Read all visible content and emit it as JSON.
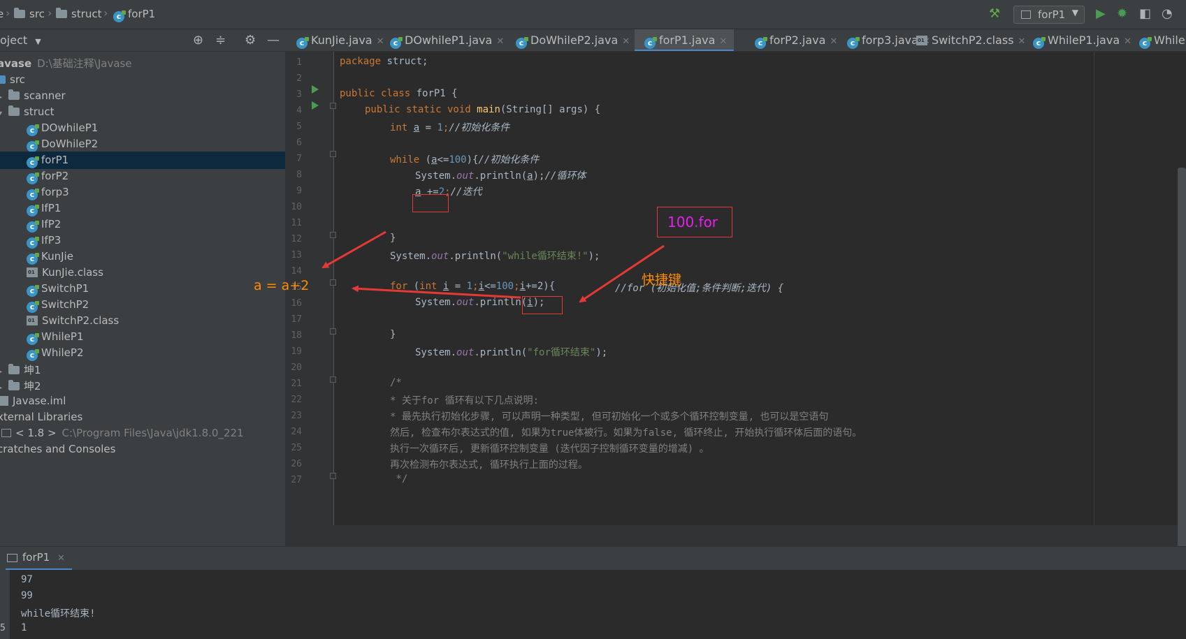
{
  "navbar": {
    "breadcrumbs": [
      "src",
      "struct",
      "forP1"
    ],
    "run_config": "forP1"
  },
  "project_panel": {
    "title": "oject"
  },
  "tabs": [
    {
      "label": "KunJie.java",
      "active": false
    },
    {
      "label": "DOwhileP1.java",
      "active": false
    },
    {
      "label": "DoWhileP2.java",
      "active": false
    },
    {
      "label": "forP1.java",
      "active": true
    },
    {
      "label": "forP2.java",
      "active": false
    },
    {
      "label": "forp3.java",
      "active": false
    },
    {
      "label": "SwitchP2.class",
      "active": false
    },
    {
      "label": "WhileP1.java",
      "active": false
    },
    {
      "label": "While",
      "active": false
    }
  ],
  "tree": {
    "root": {
      "name": "avase",
      "path": "D:\\基础注释\\Javase"
    },
    "src": "src",
    "scanner": "scanner",
    "struct": "struct",
    "files": [
      "DOwhileP1",
      "DoWhileP2",
      "forP1",
      "forP2",
      "forp3",
      "IfP1",
      "IfP2",
      "IfP3",
      "KunJie",
      "KunJie.class",
      "SwitchP1",
      "SwitchP2",
      "SwitchP2.class",
      "WhileP1",
      "WhileP2"
    ],
    "selected": "forP1",
    "folder_kun1": "坤1",
    "folder_kun2": "坤2",
    "iml": "Javase.iml",
    "external_libraries": "xternal Libraries",
    "jdk": {
      "name": "< 1.8 >",
      "path": "C:\\Program Files\\Java\\jdk1.8.0_221"
    },
    "scratches": "cratches and Consoles"
  },
  "editor": {
    "line_numbers": [
      "1",
      "2",
      "3",
      "4",
      "5",
      "6",
      "7",
      "8",
      "9",
      "10",
      "11",
      "12",
      "13",
      "14",
      "15",
      "16",
      "17",
      "18",
      "19",
      "20",
      "21",
      "22",
      "23",
      "24",
      "25",
      "26",
      "27"
    ],
    "code": {
      "l1_kw": "package",
      "l1_rest": " struct;",
      "l3_kw": "public class",
      "l3_rest": " forP1 {",
      "l4_kw": "public static void",
      "l4_meth": "main",
      "l4_rest": "(String[] args) {",
      "l5_kw": "int",
      "l5_var": "a",
      "l5_mid": " = ",
      "l5_num": "1",
      "l5_semi": ";",
      "l5_cmt": "//初始化条件",
      "l7_kw": "while",
      "l7_open": " (",
      "l7_var": "a",
      "l7_op": "<=",
      "l7_num": "100",
      "l7_close": "){",
      "l7_cmt": "//初始化条件",
      "l8_pre": "System.",
      "l8_field": "out",
      "l8_mid": ".println(",
      "l8_var": "a",
      "l8_end": ");",
      "l8_cmt": "//循环体",
      "l9_var": "a",
      "l9_op": " +=",
      "l9_num": "2",
      "l9_semi": ";",
      "l9_cmt": "//迭代",
      "l12": "}",
      "l13_pre": "System.",
      "l13_field": "out",
      "l13_mid": ".println(",
      "l13_str": "\"while循环结束!\"",
      "l13_end": ");",
      "l15_kw": "for",
      "l15_open": " (",
      "l15_kw2": "int",
      "l15_var": "i",
      "l15_eq": " = ",
      "l15_num": "1",
      "l15_semi1": ";",
      "l15_var2": "i",
      "l15_op": "<=",
      "l15_num2": "100",
      "l15_semi2": ";",
      "l15_var3": "i",
      "l15_inc": "+=2",
      "l15_close": "){",
      "l16_pre": "System.",
      "l16_field": "out",
      "l16_mid": ".println(",
      "l16_var": "i",
      "l16_end": ");",
      "l18": "}",
      "l19_pre": "System.",
      "l19_field": "out",
      "l19_mid": ".println(",
      "l19_str": "\"for循环结束\"",
      "l19_end": ");",
      "l21": "/*",
      "l22": "* 关于for 循环有以下几点说明:",
      "l23": "* 最先执行初始化步骤, 可以声明一种类型, 但可初始化一个或多个循环控制变量, 也可以是空语句",
      "l24": "然后, 检查布尔表达式的值, 如果为true体被行。如果为false, 循环终止, 开始执行循环体后面的语句。",
      "l25": "执行一次循环后, 更新循环控制变量 (迭代因子控制循环变量的增减) 。",
      "l26": "再次检测布尔表达式, 循环执行上面的过程。",
      "l27": " */"
    },
    "for_comment": "//for (初始化值;条件判断;迭代) {"
  },
  "annotations": {
    "shortcut_box": "100.for",
    "shortcut_label": "快捷键",
    "equation": "a  = a+2",
    "box_color": "#e53935",
    "orange_color": "#ff8c00",
    "magenta_color": "#e91ef0"
  },
  "run_panel": {
    "tab": "forP1",
    "output": [
      "97",
      "99",
      "while循环结束!",
      "1"
    ],
    "gutter_label": "5"
  }
}
